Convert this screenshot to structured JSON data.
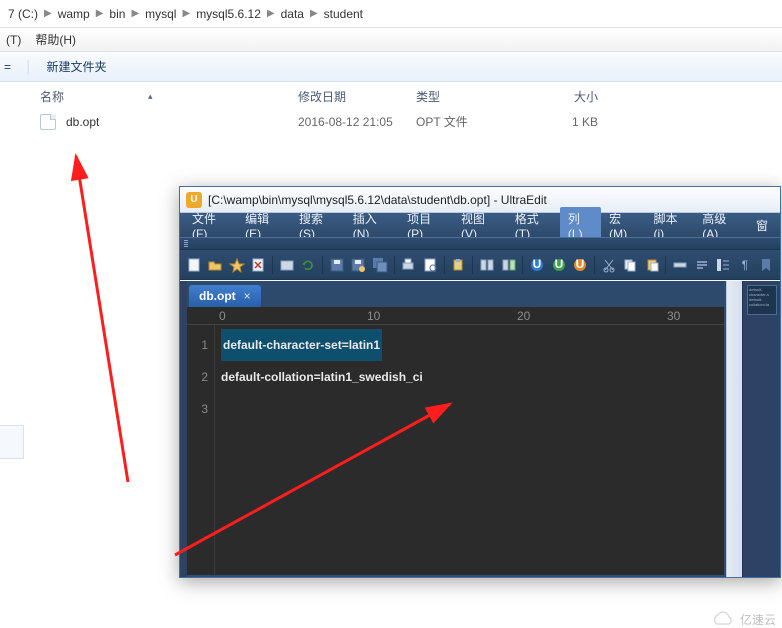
{
  "explorer": {
    "breadcrumbs": [
      "7 (C:)",
      "wamp",
      "bin",
      "mysql",
      "mysql5.6.12",
      "data",
      "student"
    ],
    "menu1": {
      "t": "(T)",
      "help": "帮助(H)"
    },
    "menu2": {
      "left": "=",
      "new_folder": "新建文件夹"
    },
    "columns": {
      "name": "名称",
      "date": "修改日期",
      "type": "类型",
      "size": "大小"
    },
    "file": {
      "name": "db.opt",
      "date": "2016-08-12  21:05",
      "type": "OPT 文件",
      "size": "1 KB"
    }
  },
  "ultraedit": {
    "title": "[C:\\wamp\\bin\\mysql\\mysql5.6.12\\data\\student\\db.opt] - UltraEdit",
    "menu": {
      "file": "文件(F)",
      "edit": "编辑(E)",
      "search": "搜索(S)",
      "insert": "插入(N)",
      "project": "项目(P)",
      "view": "视图(V)",
      "format": "格式(T)",
      "column": "列(L)",
      "macro": "宏(M)",
      "script": "脚本(i)",
      "advanced": "高级(A)",
      "more": "窗"
    },
    "tab": {
      "label": "db.opt",
      "close": "×"
    },
    "ruler": [
      "0",
      "10",
      "20",
      "30"
    ],
    "code": {
      "line1_num": "1",
      "line1_text": "default-character-set=latin1",
      "line2_num": "2",
      "line2_text": "default-collation=latin1_swedish_ci",
      "line3_num": "3"
    },
    "side_preview": "default-character-s\ndefault-collation=la"
  },
  "watermark": "亿速云",
  "icons": {
    "new": "#f4f6fa",
    "open": "#f0c46a",
    "save": "#5b7ca8",
    "saveas": "#5b7ca8",
    "print": "#cdd8e6",
    "printprev": "#cdd8e6",
    "cut": "#c7d1e0",
    "copy": "#c7d1e0",
    "paste": "#c7d1e0",
    "u_blue": "#2e7bd1",
    "u_green": "#3ca24a",
    "u_orange": "#e08a2a",
    "scis": "#bac7da",
    "dup": "#bac7da",
    "clip": "#bac7da",
    "grid": "#bac7da",
    "para": "#bac7da",
    "layout": "#bac7da",
    "hex": "#bac7da",
    "book": "#bac7da"
  }
}
